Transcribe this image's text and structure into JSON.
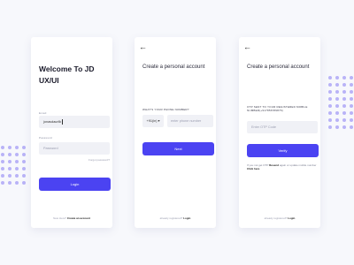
{
  "screen1": {
    "title": "Welcome To JD UX/UI",
    "email_label": "Email",
    "email_value": "jonasdaurilk",
    "password_label": "Password",
    "password_placeholder": "Password",
    "forgot_link": "Forgot password?",
    "login_button": "Login",
    "footer_prefix": "New Here?",
    "footer_link": "Create an account"
  },
  "screen2": {
    "title": "Create a personal account",
    "phone_label": "WHAT'S YOUR PHONE NUMBER?",
    "country_code": "+91(in)",
    "phone_placeholder": "enter phone number",
    "next_button": "Next",
    "footer_prefix": "already registered?",
    "footer_link": "Login"
  },
  "screen3": {
    "title": "Create a personal account",
    "otp_label": "OTP SENT TO YOUR REGISTERED MOBILE NUMBER(+917856789876)",
    "otp_placeholder": "Enter OTP Code",
    "verify_button": "Verify",
    "resend_text_1": "If you not get OTP",
    "resend_link": "Resend",
    "resend_text_2": "again or update mobile number",
    "resend_link_2": "Click here",
    "footer_prefix": "already registered?",
    "footer_link": "Login"
  },
  "colors": {
    "accent": "#4b43f2",
    "dots": "#b9b3f7",
    "background": "#f7f8fc"
  },
  "icons": {
    "back": "arrow-left-icon"
  }
}
